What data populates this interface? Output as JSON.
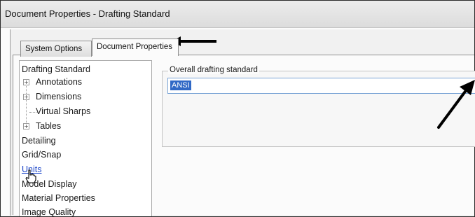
{
  "window": {
    "title": "Document Properties - Drafting Standard"
  },
  "tabs": [
    {
      "label": "System Options",
      "active": false
    },
    {
      "label": "Document Properties",
      "active": true
    }
  ],
  "tree": {
    "items": [
      {
        "label": "Drafting Standard",
        "level": 0,
        "expandable": false
      },
      {
        "label": "Annotations",
        "level": 1,
        "expandable": true
      },
      {
        "label": "Dimensions",
        "level": 1,
        "expandable": true
      },
      {
        "label": "Virtual Sharps",
        "level": 1,
        "expandable": false
      },
      {
        "label": "Tables",
        "level": 1,
        "expandable": true
      },
      {
        "label": "Detailing",
        "level": 0,
        "expandable": false
      },
      {
        "label": "Grid/Snap",
        "level": 0,
        "expandable": false
      },
      {
        "label": "Units",
        "level": 0,
        "expandable": false,
        "hovered": true
      },
      {
        "label": "Model Display",
        "level": 0,
        "expandable": false
      },
      {
        "label": "Material Properties",
        "level": 0,
        "expandable": false
      },
      {
        "label": "Image Quality",
        "level": 0,
        "expandable": false
      }
    ]
  },
  "overall_standard": {
    "label": "Overall drafting standard",
    "value": "ANSI"
  },
  "colors": {
    "selection": "#3169c6",
    "link": "#1b45c8",
    "arrow": "#000000"
  },
  "icons": [
    "plus-expander-icon",
    "hand-pointer-icon",
    "arrow-annotation-icon"
  ]
}
